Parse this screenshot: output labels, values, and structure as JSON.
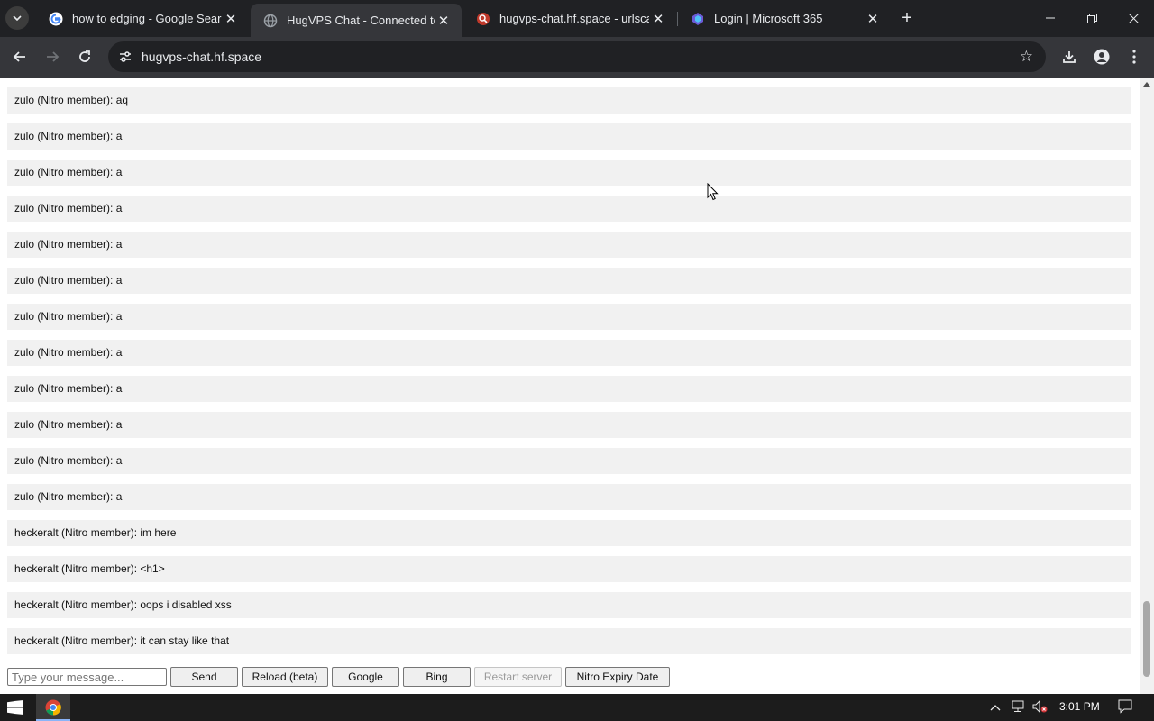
{
  "browser": {
    "tabs": [
      {
        "title": "how to edging - Google Search",
        "favicon": "google-icon",
        "active": false
      },
      {
        "title": "HugVPS Chat - Connected to se",
        "favicon": "globe-icon",
        "active": true
      },
      {
        "title": "hugvps-chat.hf.space - urlscan.",
        "favicon": "urlscan-icon",
        "active": false
      },
      {
        "title": "Login | Microsoft 365",
        "favicon": "microsoft365-icon",
        "active": false
      }
    ],
    "url": "hugvps-chat.hf.space"
  },
  "chat": {
    "messages": [
      "zulo (Nitro member): aq",
      "zulo (Nitro member): a",
      "zulo (Nitro member): a",
      "zulo (Nitro member): a",
      "zulo (Nitro member): a",
      "zulo (Nitro member): a",
      "zulo (Nitro member): a",
      "zulo (Nitro member): a",
      "zulo (Nitro member): a",
      "zulo (Nitro member): a",
      "zulo (Nitro member): a",
      "zulo (Nitro member): a",
      "heckeralt (Nitro member): im here",
      "heckeralt (Nitro member): <h1>",
      "heckeralt (Nitro member): oops i disabled xss",
      "heckeralt (Nitro member): it can stay like that"
    ],
    "input_placeholder": "Type your message...",
    "buttons": {
      "send": "Send",
      "reload": "Reload (beta)",
      "google": "Google",
      "bing": "Bing",
      "restart": "Restart server",
      "nitro": "Nitro Expiry Date"
    }
  },
  "taskbar": {
    "time": "3:01 PM"
  }
}
